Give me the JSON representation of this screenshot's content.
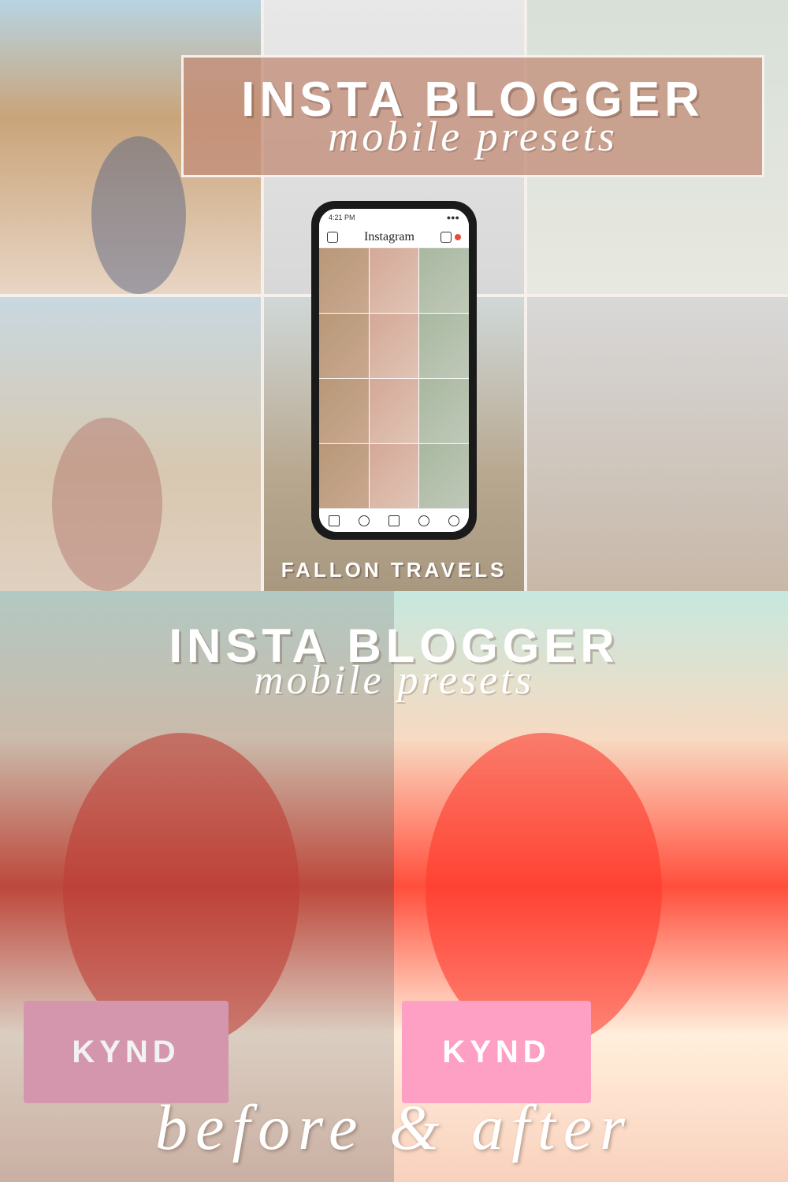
{
  "banner": {
    "title": "INSTA BLOGGER",
    "subtitle": "mobile presets"
  },
  "brand": "FALLON TRAVELS",
  "phone": {
    "time": "4:21 PM",
    "app": "Instagram"
  },
  "bottom": {
    "title": "INSTA BLOGGER",
    "subtitle": "mobile presets",
    "comparison": "before & after",
    "menu_text": "KYND"
  }
}
